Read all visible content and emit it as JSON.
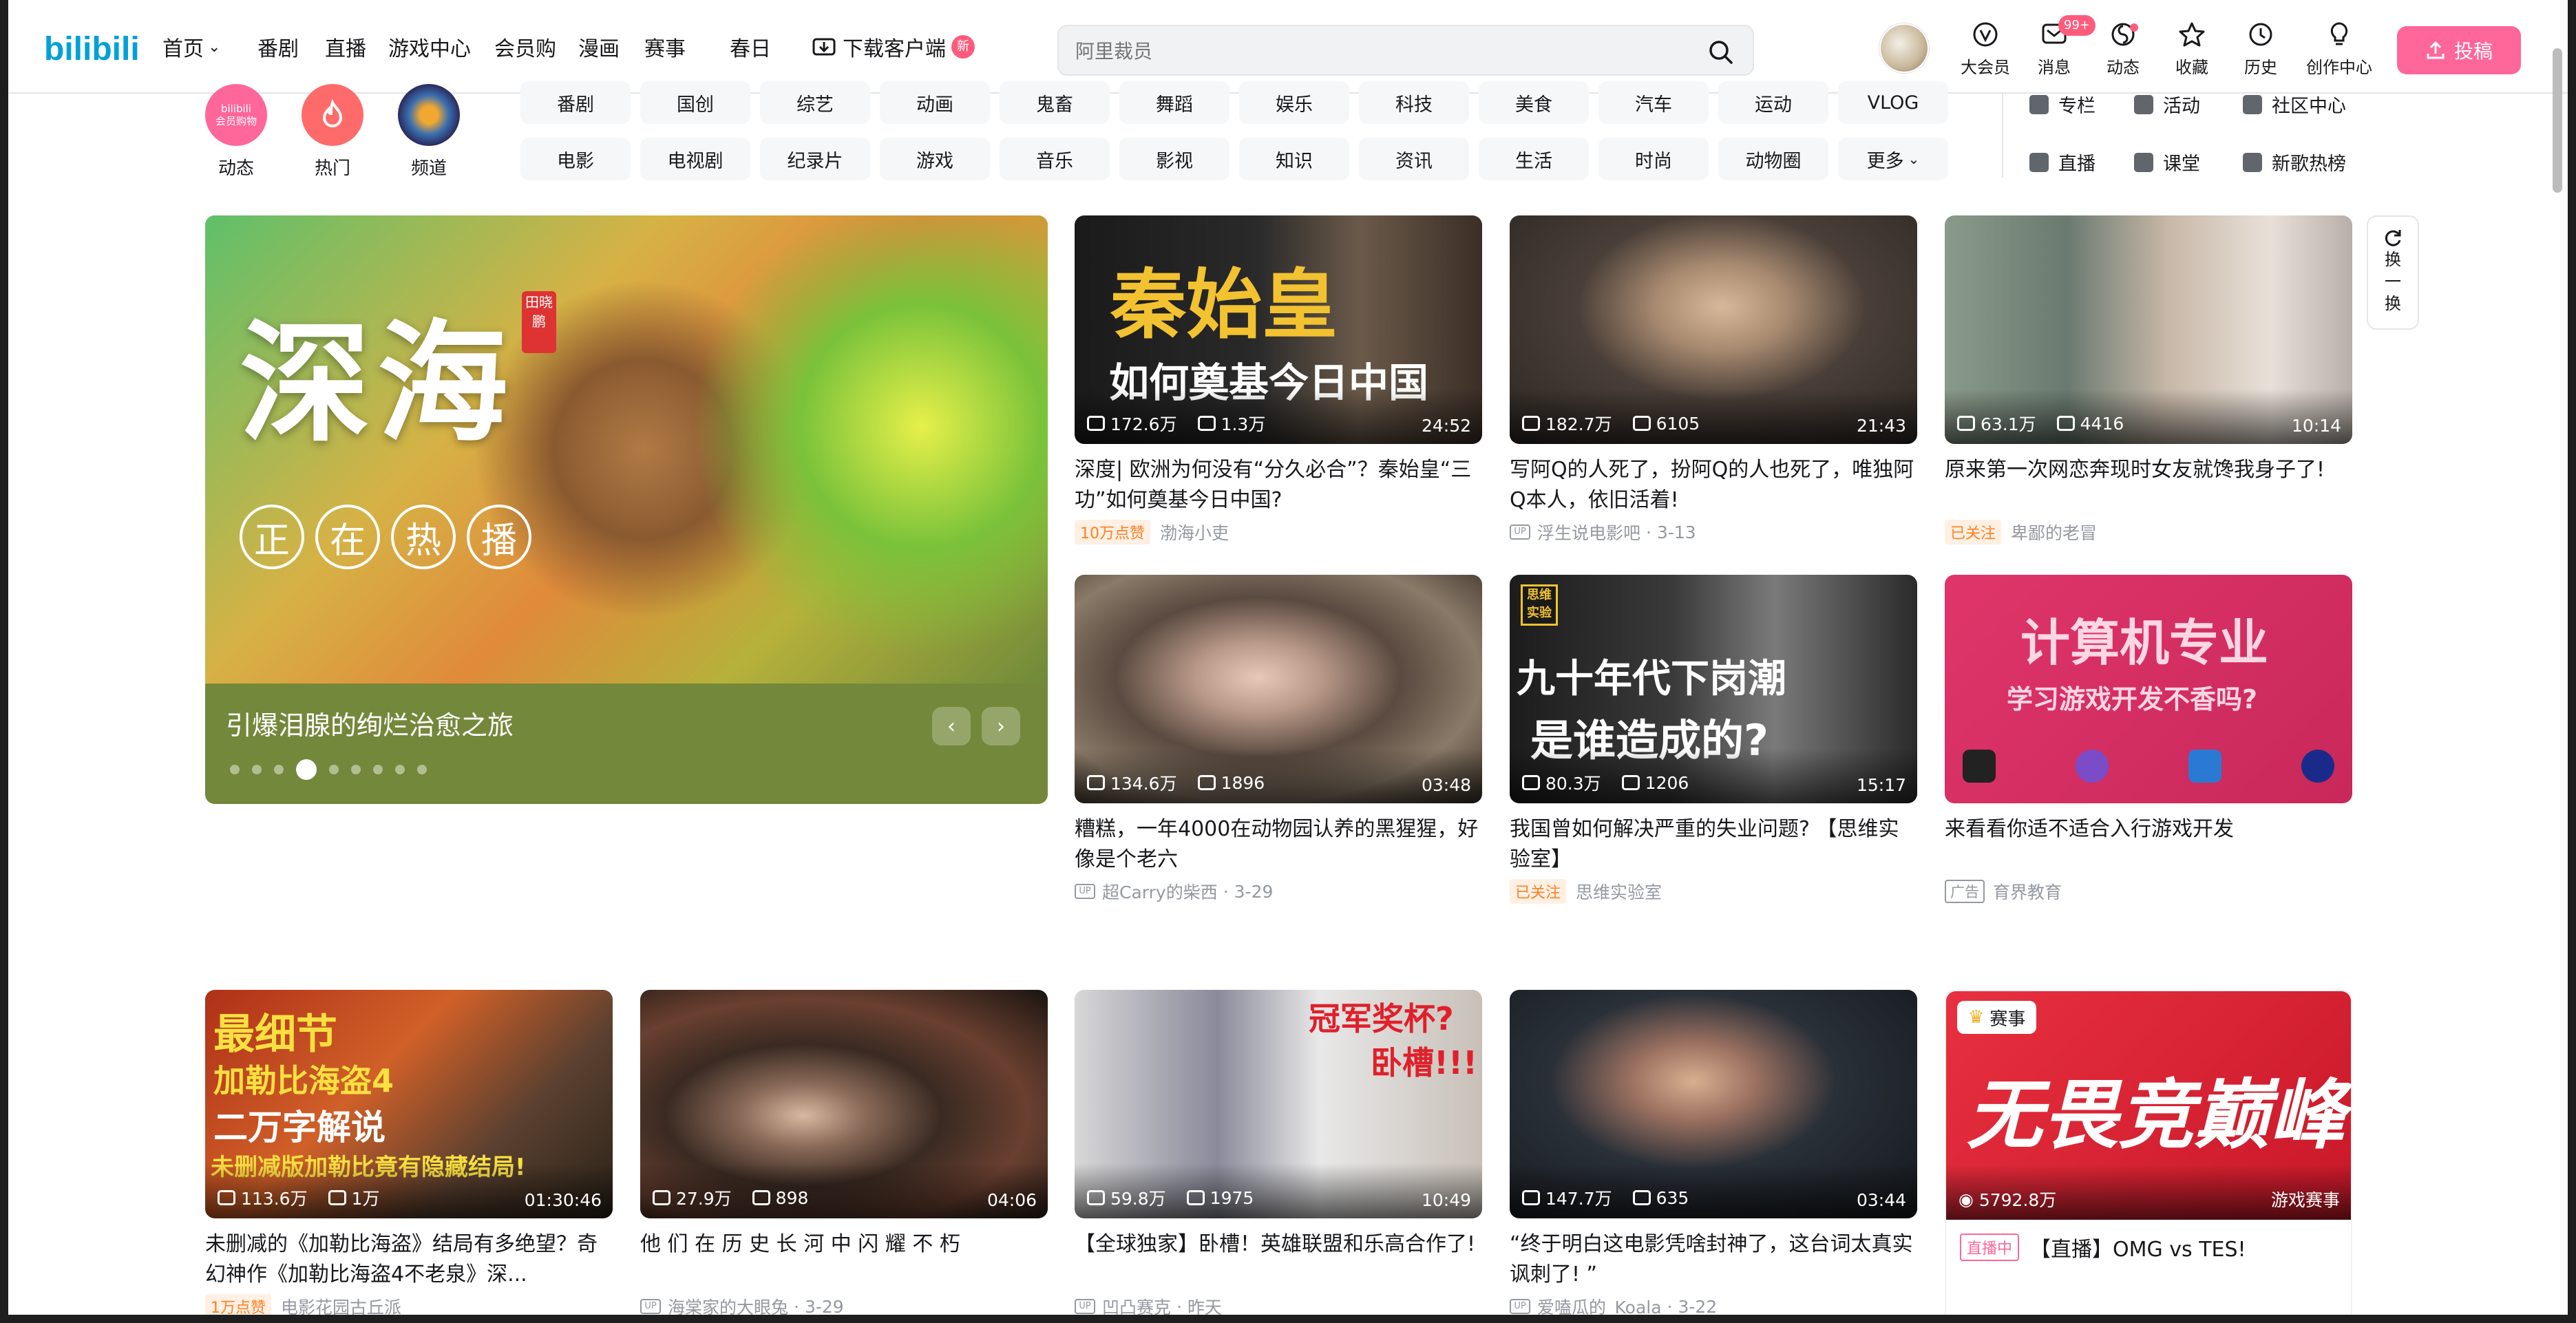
{
  "header": {
    "nav": [
      {
        "label": "首页",
        "chevron": true
      },
      {
        "label": "番剧"
      },
      {
        "label": "直播"
      },
      {
        "label": "游戏中心"
      },
      {
        "label": "会员购"
      },
      {
        "label": "漫画"
      },
      {
        "label": "赛事"
      },
      {
        "label": "春日"
      }
    ],
    "download_label": "下载客户端",
    "download_badge": "新",
    "search_placeholder": "阿里裁员",
    "icons": [
      {
        "label": "大会员",
        "icon": "vip-icon"
      },
      {
        "label": "消息",
        "icon": "message-icon",
        "badge": "99+"
      },
      {
        "label": "动态",
        "icon": "dynamic-icon",
        "dot": true
      },
      {
        "label": "收藏",
        "icon": "star-icon"
      },
      {
        "label": "历史",
        "icon": "clock-icon"
      },
      {
        "label": "创作中心",
        "icon": "bulb-icon"
      }
    ],
    "upload_label": "投稿"
  },
  "channels": {
    "circles": [
      {
        "label": "动态",
        "logo": "bilibili 会员购物"
      },
      {
        "label": "热门"
      },
      {
        "label": "频道"
      }
    ],
    "row1": [
      "番剧",
      "国创",
      "综艺",
      "动画",
      "鬼畜",
      "舞蹈",
      "娱乐",
      "科技",
      "美食",
      "汽车",
      "运动",
      "VLOG"
    ],
    "row2": [
      "电影",
      "电视剧",
      "纪录片",
      "游戏",
      "音乐",
      "影视",
      "知识",
      "资讯",
      "生活",
      "时尚",
      "动物圈",
      "更多"
    ],
    "right_links": [
      "专栏",
      "活动",
      "社区中心",
      "直播",
      "课堂",
      "新歌热榜"
    ]
  },
  "banner": {
    "title": "引爆泪腺的绚烂治愈之旅",
    "art_title": "深海",
    "art_seal": "田晓鹏",
    "art_sub": [
      "正",
      "在",
      "热",
      "播"
    ],
    "dot_count": 9,
    "active_dot": 3
  },
  "refresh_label": [
    "换",
    "一",
    "换"
  ],
  "cards": [
    {
      "thumb_text": [
        "秦始皇",
        "如何奠基今日中国"
      ],
      "views": "172.6万",
      "danmaku": "1.3万",
      "duration": "24:52",
      "title": "深度| 欧洲为何没有“分久必合”？秦始皇“三功”如何奠基今日中国?",
      "badge": "10万点赞",
      "author": "渤海小吏",
      "date": ""
    },
    {
      "thumb_text": [],
      "views": "182.7万",
      "danmaku": "6105",
      "duration": "21:43",
      "title": "写阿Q的人死了，扮阿Q的人也死了，唯独阿Q本人，依旧活着!",
      "badge": "",
      "author": "浮生说电影吧",
      "date": "3-13"
    },
    {
      "thumb_text": [],
      "views": "63.1万",
      "danmaku": "4416",
      "duration": "10:14",
      "title": "原来第一次网恋奔现时女友就馋我身子了!",
      "badge": "已关注",
      "author": "卑鄙的老冒",
      "date": ""
    },
    {
      "thumb_text": [],
      "views": "134.6万",
      "danmaku": "1896",
      "duration": "03:48",
      "title": "糟糕，一年4000在动物园认养的黑猩猩，好像是个老六",
      "badge": "",
      "author": "超Carry的柴西",
      "date": "3-29"
    },
    {
      "thumb_text": [
        "九十年代下岗潮",
        "是谁造成的?",
        "思维",
        "实验"
      ],
      "views": "80.3万",
      "danmaku": "1206",
      "duration": "15:17",
      "title": "我国曾如何解决严重的失业问题? 【思维实验室】",
      "badge": "已关注",
      "author": "思维实验室",
      "date": ""
    },
    {
      "thumb_text": [
        "计算机专业",
        "学习游戏开发不香吗?"
      ],
      "ad": true,
      "title": "来看看你适不适合入行游戏开发",
      "ad_label": "广告",
      "author": "育界教育"
    },
    {
      "thumb_text": [
        "最细节",
        "加勒比海盗4",
        "二万字解说",
        "未删减版加勒比竟有隐藏结局!"
      ],
      "views": "113.6万",
      "danmaku": "1万",
      "duration": "01:30:46",
      "title": "未删减的《加勒比海盗》结局有多绝望？奇幻神作《加勒比海盗4不老泉》深...",
      "badge": "1万点赞",
      "author": "电影花园古丘派",
      "date": ""
    },
    {
      "thumb_text": [],
      "views": "27.9万",
      "danmaku": "898",
      "duration": "04:06",
      "title": "他 们 在 历 史 长 河 中 闪 耀 不 朽",
      "badge": "",
      "author": "海棠家的大眼兔",
      "date": "3-29"
    },
    {
      "thumb_text": [
        "冠军奖杯?",
        "卧槽!!!"
      ],
      "views": "59.8万",
      "danmaku": "1975",
      "duration": "10:49",
      "title": "【全球独家】卧槽！英雄联盟和乐高合作了!",
      "badge": "",
      "author": "凹凸赛克",
      "date": "昨天"
    },
    {
      "thumb_text": [],
      "views": "147.7万",
      "danmaku": "635",
      "duration": "03:44",
      "title": "“终于明白这电影凭啥封神了，这台词太真实讽刺了! ”",
      "badge": "",
      "author": "爱嗑瓜的_Koala",
      "date": "3-22"
    },
    {
      "thumb_text": [
        "无畏竞巅峰"
      ],
      "live": true,
      "tag": "赛事",
      "views": "5792.8万",
      "category": "游戏赛事",
      "live_label": "直播中",
      "title": "【直播】OMG vs TES!"
    }
  ]
}
